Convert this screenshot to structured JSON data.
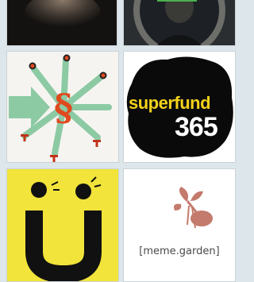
{
  "tiles": [
    {
      "id": "photo-hand",
      "alt": ""
    },
    {
      "id": "photo-portrait",
      "alt": ""
    },
    {
      "id": "paragraph-logo",
      "alt": ""
    },
    {
      "id": "superfund-logo",
      "text_top": "superfund",
      "text_bottom": "365"
    },
    {
      "id": "u-umlaut-logo",
      "alt": ""
    },
    {
      "id": "meme-garden-logo",
      "caption": "[meme.garden]"
    }
  ],
  "colors": {
    "paragraph_green": "#8ccaa4",
    "paragraph_red": "#e04a1f",
    "superfund_yellow": "#f2d21b",
    "u_yellow": "#f2e43a",
    "meme_pink": "#c47a6c"
  }
}
